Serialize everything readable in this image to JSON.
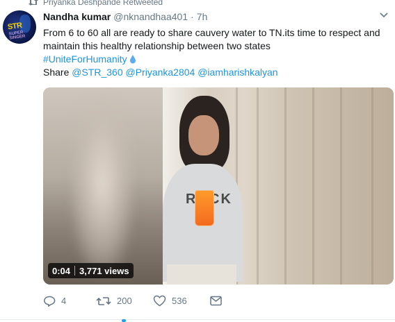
{
  "retweet_notice": {
    "text": "Priyanka Deshpande Retweeted"
  },
  "tweet": {
    "author_name": "Nandha kumar",
    "author_handle": "@nknandhaa401",
    "separator": "·",
    "time": "7h",
    "text_line1": "From 6 to 60 all are ready to share cauvery water to TN.its time to respect and",
    "text_line2": "maintain this healthy relationship between two states",
    "hashtag": "#UniteForHumanity",
    "share_label": "Share",
    "mentions": [
      "@STR_360",
      "@Priyanka2804",
      "@iamharishkalyan"
    ],
    "avatar_text": "STR",
    "avatar_sub": "SUPER SINGER"
  },
  "video": {
    "duration": "0:04",
    "views": "3,771 views",
    "shirt_print": "ROCK"
  },
  "actions": {
    "replies": "4",
    "retweets": "200",
    "likes": "536"
  },
  "colors": {
    "link": "#1b95e0",
    "muted": "#657786"
  }
}
